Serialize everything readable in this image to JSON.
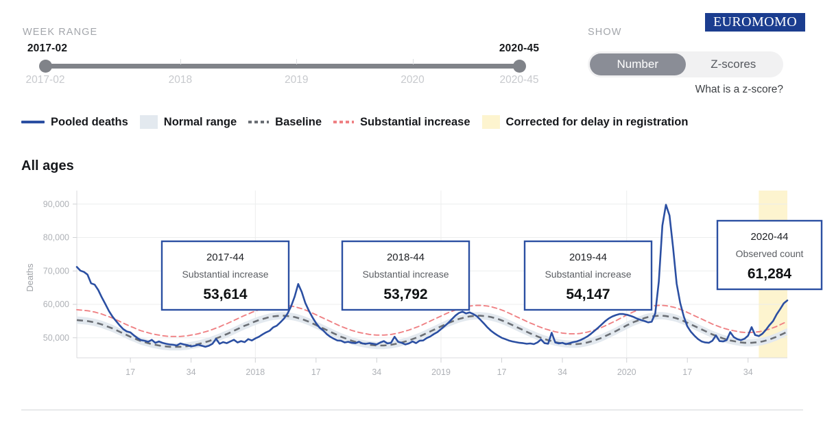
{
  "header": {
    "week_range_label": "WEEK RANGE",
    "show_label": "SHOW",
    "logo_text": "EUROMOMO",
    "zscore_link": "What is a z-score?"
  },
  "slider": {
    "start_value": "2017-02",
    "end_value": "2020-45",
    "ticks": [
      {
        "label": "2017-02",
        "pos": 0
      },
      {
        "label": "2018",
        "pos": 0.285
      },
      {
        "label": "2019",
        "pos": 0.53
      },
      {
        "label": "2020",
        "pos": 0.775
      },
      {
        "label": "2020-45",
        "pos": 1
      }
    ]
  },
  "toggle": {
    "options": [
      {
        "label": "Number",
        "active": true
      },
      {
        "label": "Z-scores",
        "active": false
      }
    ]
  },
  "legend": [
    {
      "label": "Pooled deaths",
      "style": "line",
      "color": "#2b4fa2"
    },
    {
      "label": "Normal range",
      "style": "box",
      "color": "#e3e9ef"
    },
    {
      "label": "Baseline",
      "style": "dash-grey",
      "color": "#6b6f75"
    },
    {
      "label": "Substantial increase",
      "style": "dash-red",
      "color": "#ef8083"
    },
    {
      "label": "Corrected for delay in registration",
      "style": "box-yellow",
      "color": "#fdf4cf"
    }
  ],
  "chart_data": {
    "type": "line",
    "title": "All ages",
    "ylabel": "Deaths",
    "xlabel": "",
    "ylim": [
      44000,
      92000
    ],
    "yticks": [
      50000,
      60000,
      70000,
      80000,
      90000
    ],
    "ytick_labels": [
      "50,000",
      "60,000",
      "70,000",
      "80,000",
      "90,000"
    ],
    "grid": true,
    "legend_position": "above",
    "xticks": [
      {
        "label": "17",
        "week_index": 15
      },
      {
        "label": "34",
        "week_index": 32
      },
      {
        "label": "2018",
        "week_index": 50
      },
      {
        "label": "17",
        "week_index": 67
      },
      {
        "label": "34",
        "week_index": 84
      },
      {
        "label": "2019",
        "week_index": 102
      },
      {
        "label": "17",
        "week_index": 119
      },
      {
        "label": "34",
        "week_index": 136
      },
      {
        "label": "2020",
        "week_index": 154
      },
      {
        "label": "17",
        "week_index": 171
      },
      {
        "label": "34",
        "week_index": 188
      }
    ],
    "x_start_label": "2017-02",
    "x_end_label": "2020-45",
    "n_weeks": 200,
    "corrected_band": {
      "start_week": 191,
      "end_week": 200,
      "color": "#fdf4cf"
    },
    "series": [
      {
        "name": "Pooled deaths",
        "color": "#2b4fa2",
        "values": [
          71200,
          70100,
          69700,
          68900,
          66300,
          65900,
          64300,
          62100,
          60100,
          58000,
          56300,
          55000,
          53700,
          52600,
          51900,
          51600,
          50700,
          49900,
          49300,
          49100,
          48800,
          49400,
          48500,
          48900,
          48500,
          48200,
          48000,
          47900,
          47700,
          48300,
          48000,
          47800,
          47400,
          47600,
          47900,
          47600,
          47300,
          47600,
          48200,
          49700,
          48200,
          48700,
          48400,
          48900,
          49400,
          48600,
          49000,
          48700,
          49600,
          49200,
          49800,
          50300,
          51000,
          51600,
          52100,
          53100,
          53600,
          54600,
          55700,
          57200,
          59400,
          62300,
          66100,
          63700,
          60400,
          58100,
          56100,
          54400,
          53000,
          52200,
          51100,
          50300,
          49700,
          49200,
          49100,
          48600,
          48800,
          48500,
          48400,
          48800,
          48300,
          48200,
          48400,
          48200,
          48000,
          48600,
          49000,
          48300,
          48500,
          50300,
          48800,
          48500,
          48000,
          48300,
          48900,
          48400,
          49100,
          49200,
          49900,
          50400,
          51100,
          51700,
          52600,
          53500,
          54400,
          55500,
          56600,
          57400,
          57800,
          57300,
          57600,
          57100,
          56500,
          55400,
          54300,
          53100,
          52100,
          51300,
          50600,
          50000,
          49600,
          49200,
          48900,
          48700,
          48500,
          48400,
          48200,
          48300,
          48100,
          48600,
          49500,
          48400,
          48200,
          51500,
          48600,
          48300,
          48500,
          48100,
          48400,
          48700,
          48900,
          49300,
          49800,
          50400,
          51200,
          52100,
          53000,
          54000,
          55000,
          55800,
          56400,
          56800,
          57100,
          57100,
          56900,
          56600,
          56200,
          55700,
          55300,
          55000,
          54600,
          54800,
          57300,
          66800,
          83600,
          89800,
          86600,
          77000,
          66200,
          60400,
          56400,
          53400,
          51800,
          50600,
          49600,
          48900,
          48600,
          48500,
          49100,
          50700,
          49000,
          48900,
          49300,
          51700,
          50200,
          49600,
          49300,
          49700,
          50600,
          53200,
          50800,
          50500,
          51200,
          52400,
          53800,
          55000,
          57000,
          58600,
          60300,
          61200
        ]
      },
      {
        "name": "Baseline",
        "color": "#6b6f75",
        "style": "dashed",
        "values": [
          55300,
          55200,
          55100,
          55000,
          54800,
          54600,
          54300,
          54000,
          53600,
          53200,
          52800,
          52300,
          51800,
          51300,
          50800,
          50300,
          49900,
          49400,
          49000,
          48700,
          48400,
          48100,
          47900,
          47700,
          47500,
          47400,
          47300,
          47300,
          47300,
          47300,
          47400,
          47500,
          47700,
          47900,
          48100,
          48400,
          48700,
          49000,
          49400,
          49800,
          50200,
          50700,
          51100,
          51600,
          52100,
          52600,
          53100,
          53600,
          54000,
          54500,
          54900,
          55300,
          55600,
          55900,
          56200,
          56400,
          56500,
          56600,
          56600,
          56500,
          56400,
          56200,
          55900,
          55600,
          55200,
          54800,
          54300,
          53800,
          53300,
          52800,
          52300,
          51800,
          51300,
          50800,
          50300,
          49900,
          49500,
          49100,
          48800,
          48500,
          48300,
          48100,
          47900,
          47800,
          47700,
          47700,
          47700,
          47800,
          47900,
          48100,
          48300,
          48600,
          48900,
          49200,
          49600,
          50000,
          50400,
          50900,
          51400,
          51900,
          52400,
          52900,
          53400,
          53900,
          54400,
          54800,
          55200,
          55600,
          55900,
          56200,
          56400,
          56500,
          56600,
          56600,
          56500,
          56400,
          56200,
          55900,
          55600,
          55200,
          54800,
          54300,
          53800,
          53300,
          52800,
          52300,
          51800,
          51300,
          50900,
          50400,
          50000,
          49600,
          49300,
          49000,
          48700,
          48500,
          48300,
          48200,
          48100,
          48100,
          48100,
          48200,
          48400,
          48600,
          48900,
          49200,
          49600,
          50000,
          50500,
          51000,
          51500,
          52000,
          52600,
          53100,
          53700,
          54200,
          54700,
          55100,
          55500,
          55900,
          56200,
          56400,
          56500,
          56600,
          56600,
          56500,
          56300,
          56100,
          55800,
          55400,
          55000,
          54500,
          54000,
          53500,
          53000,
          52500,
          52000,
          51500,
          51000,
          50600,
          50200,
          49800,
          49500,
          49200,
          49000,
          48800,
          48600,
          48500,
          48500,
          48500,
          48600,
          48700,
          48900,
          49200,
          49500,
          49900,
          50300,
          50800,
          51300,
          51800
        ]
      },
      {
        "name": "Substantial increase",
        "color": "#ef8083",
        "style": "dashed",
        "values": [
          58400,
          58300,
          58200,
          58100,
          57900,
          57700,
          57400,
          57100,
          56700,
          56300,
          55900,
          55400,
          54900,
          54400,
          53900,
          53400,
          53000,
          52500,
          52100,
          51800,
          51500,
          51200,
          51000,
          50800,
          50600,
          50500,
          50400,
          50400,
          50400,
          50400,
          50500,
          50600,
          50800,
          51000,
          51200,
          51500,
          51800,
          52100,
          52500,
          52900,
          53300,
          53800,
          54200,
          54700,
          55200,
          55700,
          56200,
          56700,
          57100,
          57600,
          58000,
          58400,
          58700,
          59000,
          59300,
          59500,
          59600,
          59700,
          59700,
          59600,
          59500,
          59300,
          59000,
          58700,
          58300,
          57900,
          57400,
          56900,
          56400,
          55900,
          55400,
          54900,
          54400,
          53900,
          53400,
          53000,
          52600,
          52200,
          51900,
          51600,
          51400,
          51200,
          51000,
          50900,
          50800,
          50800,
          50800,
          50900,
          51000,
          51200,
          51400,
          51700,
          52000,
          52300,
          52700,
          53100,
          53500,
          54000,
          54500,
          55000,
          55500,
          56000,
          56500,
          57000,
          57500,
          57900,
          58300,
          58700,
          59000,
          59300,
          59500,
          59600,
          59700,
          59700,
          59600,
          59500,
          59300,
          59000,
          58700,
          58300,
          57900,
          57400,
          56900,
          56400,
          55900,
          55400,
          54900,
          54400,
          54000,
          53500,
          53100,
          52700,
          52400,
          52100,
          51800,
          51600,
          51400,
          51300,
          51200,
          51200,
          51200,
          51300,
          51500,
          51700,
          52000,
          52300,
          52700,
          53100,
          53600,
          54100,
          54600,
          55100,
          55700,
          56200,
          56800,
          57300,
          57800,
          58200,
          58600,
          59000,
          59300,
          59500,
          59600,
          59700,
          59700,
          59600,
          59400,
          59200,
          58900,
          58500,
          58100,
          57600,
          57100,
          56600,
          56100,
          55600,
          55100,
          54600,
          54100,
          53700,
          53300,
          52900,
          52600,
          52300,
          52100,
          51900,
          51700,
          51600,
          51600,
          51600,
          51700,
          51800,
          52000,
          52300,
          52600,
          53000,
          53400,
          53900,
          54400,
          54900
        ]
      }
    ],
    "normal_range": {
      "name": "Normal range",
      "color": "#e3e9ef",
      "half_width": 1100
    },
    "annotations": [
      {
        "week": "2017-44",
        "kind": "Substantial increase",
        "value": "53,614",
        "box": {
          "x": 236,
          "y": 352,
          "w": 185,
          "h": 100
        }
      },
      {
        "week": "2018-44",
        "kind": "Substantial increase",
        "value": "53,792",
        "box": {
          "x": 499,
          "y": 352,
          "w": 185,
          "h": 100
        }
      },
      {
        "week": "2019-44",
        "kind": "Substantial increase",
        "value": "54,147",
        "box": {
          "x": 765,
          "y": 352,
          "w": 185,
          "h": 100
        }
      },
      {
        "week": "2020-44",
        "kind": "Observed count",
        "value": "61,284",
        "box": {
          "x": 1046,
          "y": 322,
          "w": 152,
          "h": 100
        }
      }
    ]
  }
}
